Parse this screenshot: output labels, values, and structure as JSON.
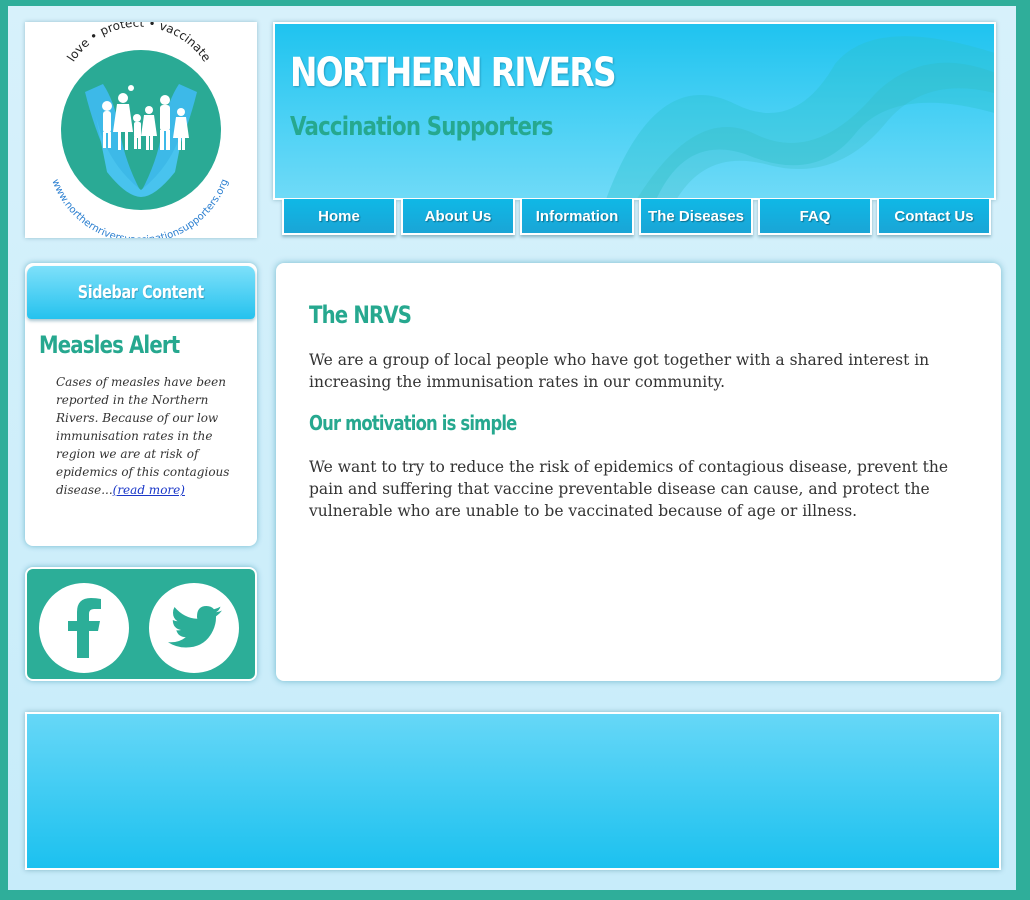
{
  "logo": {
    "tagline": "love • protect • vaccinate",
    "url_text": "www.northernriversvaccinationsupporters.org"
  },
  "header": {
    "title": "NORTHERN RIVERS",
    "subtitle": "Vaccination Supporters"
  },
  "nav": {
    "items": [
      {
        "label": "Home"
      },
      {
        "label": "About Us"
      },
      {
        "label": "Information"
      },
      {
        "label": "The Diseases"
      },
      {
        "label": "FAQ"
      },
      {
        "label": "Contact Us"
      }
    ]
  },
  "sidebar": {
    "header": "Sidebar Content",
    "alert_title": "Measles Alert",
    "alert_text": "Cases of measles have been reported in the Northern Rivers. Because of our low immunisation rates in the region we are at risk of epidemics of this contagious disease...",
    "read_more": "(read more)"
  },
  "social": {
    "facebook_icon": "facebook-icon",
    "twitter_icon": "twitter-icon"
  },
  "main": {
    "heading": "The NRVS",
    "paragraph1": "We are a group of local people who have got together with a shared interest in increasing the immunisation rates in our community.",
    "subheading": "Our motivation is simple",
    "paragraph2": "We want to try to reduce the risk of epidemics of contagious disease, prevent the pain and suffering that vaccine preventable disease can cause, and protect the vulnerable who are unable to be vaccinated because of age or illness."
  },
  "colors": {
    "accent_teal": "#26a88f",
    "sky_blue": "#1fc3ef",
    "frame": "#2fae9a"
  }
}
